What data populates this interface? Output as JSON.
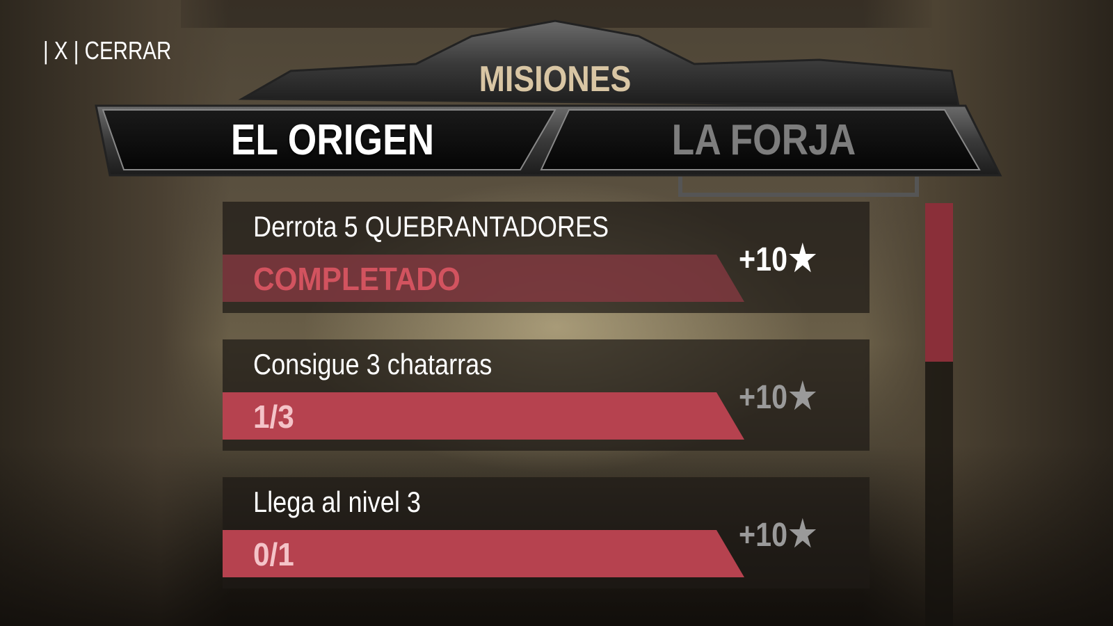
{
  "close": {
    "label": "| X | CERRAR"
  },
  "header": {
    "title": "MISIONES"
  },
  "tabs": [
    {
      "label": "EL ORIGEN",
      "active": true
    },
    {
      "label": "LA FORJA",
      "active": false
    }
  ],
  "missions": [
    {
      "description": "Derrota 5 QUEBRANTADORES",
      "status": "COMPLETADO",
      "progress": 1.0,
      "completed": true,
      "reward": "+10"
    },
    {
      "description": "Consigue 3 chatarras",
      "status": "1/3",
      "progress": 0.333,
      "completed": false,
      "reward": "+10"
    },
    {
      "description": "Llega al nivel 3",
      "status": "0/1",
      "progress": 0.0,
      "completed": false,
      "reward": "+10"
    }
  ],
  "reward_icon": "star-icon",
  "colors": {
    "accent": "#b6424f",
    "completed_bar": "#8a3a43",
    "completed_text": "#d2535f",
    "progress_text": "#f4c3c8",
    "title": "#d9c6a4",
    "inactive_tab": "#7d7d7d"
  },
  "scroll": {
    "position": 0.375
  }
}
